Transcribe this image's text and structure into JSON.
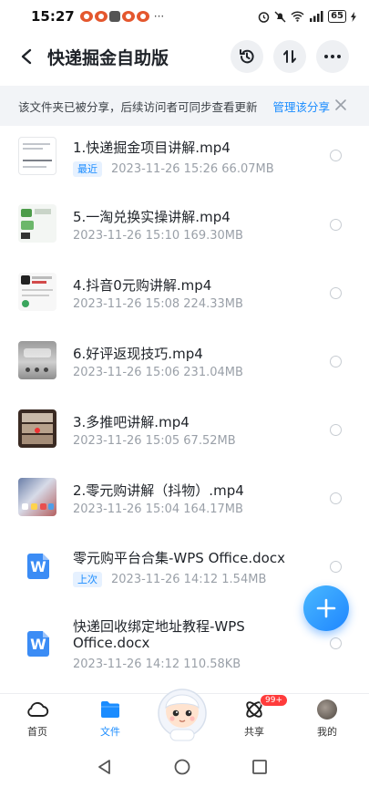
{
  "status_bar": {
    "time": "15:27",
    "more": "···",
    "battery": "65"
  },
  "header": {
    "title": "快递掘金自助版"
  },
  "banner": {
    "text": "该文件夹已被分享，后续访问者可同步查看更新",
    "link": "管理该分享"
  },
  "files": [
    {
      "name": "1.快递掘金项目讲解.mp4",
      "badge": "最近",
      "meta": "2023-11-26  15:26  66.07MB"
    },
    {
      "name": "5.一淘兑换实操讲解.mp4",
      "badge": "",
      "meta": "2023-11-26  15:10  169.30MB"
    },
    {
      "name": "4.抖音0元购讲解.mp4",
      "badge": "",
      "meta": "2023-11-26  15:08  224.33MB"
    },
    {
      "name": "6.好评返现技巧.mp4",
      "badge": "",
      "meta": "2023-11-26  15:06  231.04MB"
    },
    {
      "name": "3.多推吧讲解.mp4",
      "badge": "",
      "meta": "2023-11-26  15:05  67.52MB"
    },
    {
      "name": "2.零元购讲解（抖物）.mp4",
      "badge": "",
      "meta": "2023-11-26  15:04  164.17MB"
    },
    {
      "name": "零元购平台合集-WPS Office.docx",
      "badge": "上次",
      "meta": "2023-11-26  14:12  1.54MB"
    },
    {
      "name_line1": "快递回收绑定地址教程-WPS",
      "name_line2": "Office.docx",
      "badge": "",
      "meta": "2023-11-26  14:12  110.58KB"
    }
  ],
  "doc_icon_letter": "W",
  "bottom_nav": {
    "home": "首页",
    "files": "文件",
    "share": "共享",
    "share_badge": "99+",
    "me": "我的"
  },
  "colors": {
    "accent": "#1a8cff",
    "fab": "#1f86ff",
    "badge_red": "#ff3b3b"
  }
}
